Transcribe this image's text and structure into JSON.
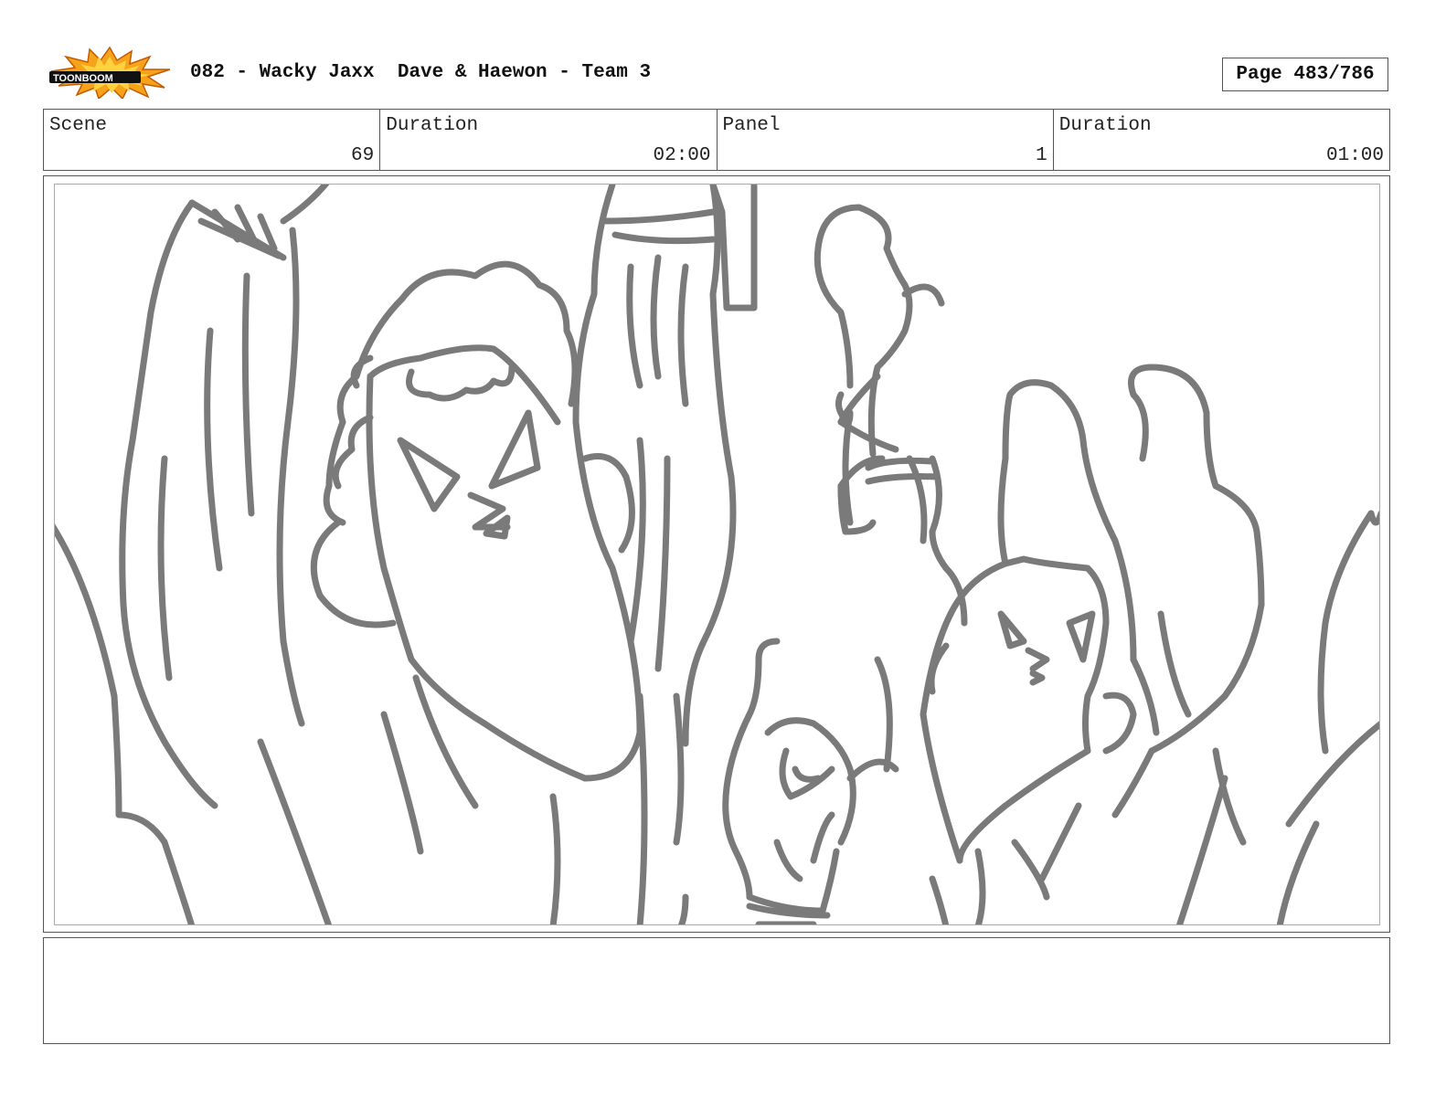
{
  "header": {
    "logo_text": "TOONBOOM",
    "title": "082 - Wacky Jaxx  Dave & Haewon - Team 3",
    "page_label": "Page 483/786"
  },
  "info": {
    "scene_label": "Scene",
    "scene_value": "69",
    "duration_label": "Duration",
    "duration_value": "02:00",
    "panel_label": "Panel",
    "panel_value": "1",
    "panel_duration_label": "Duration",
    "panel_duration_value": "01:00"
  },
  "panel": {
    "content": "storyboard-sketch",
    "line_color": "#7a7a7a"
  },
  "notes": {
    "text": ""
  }
}
